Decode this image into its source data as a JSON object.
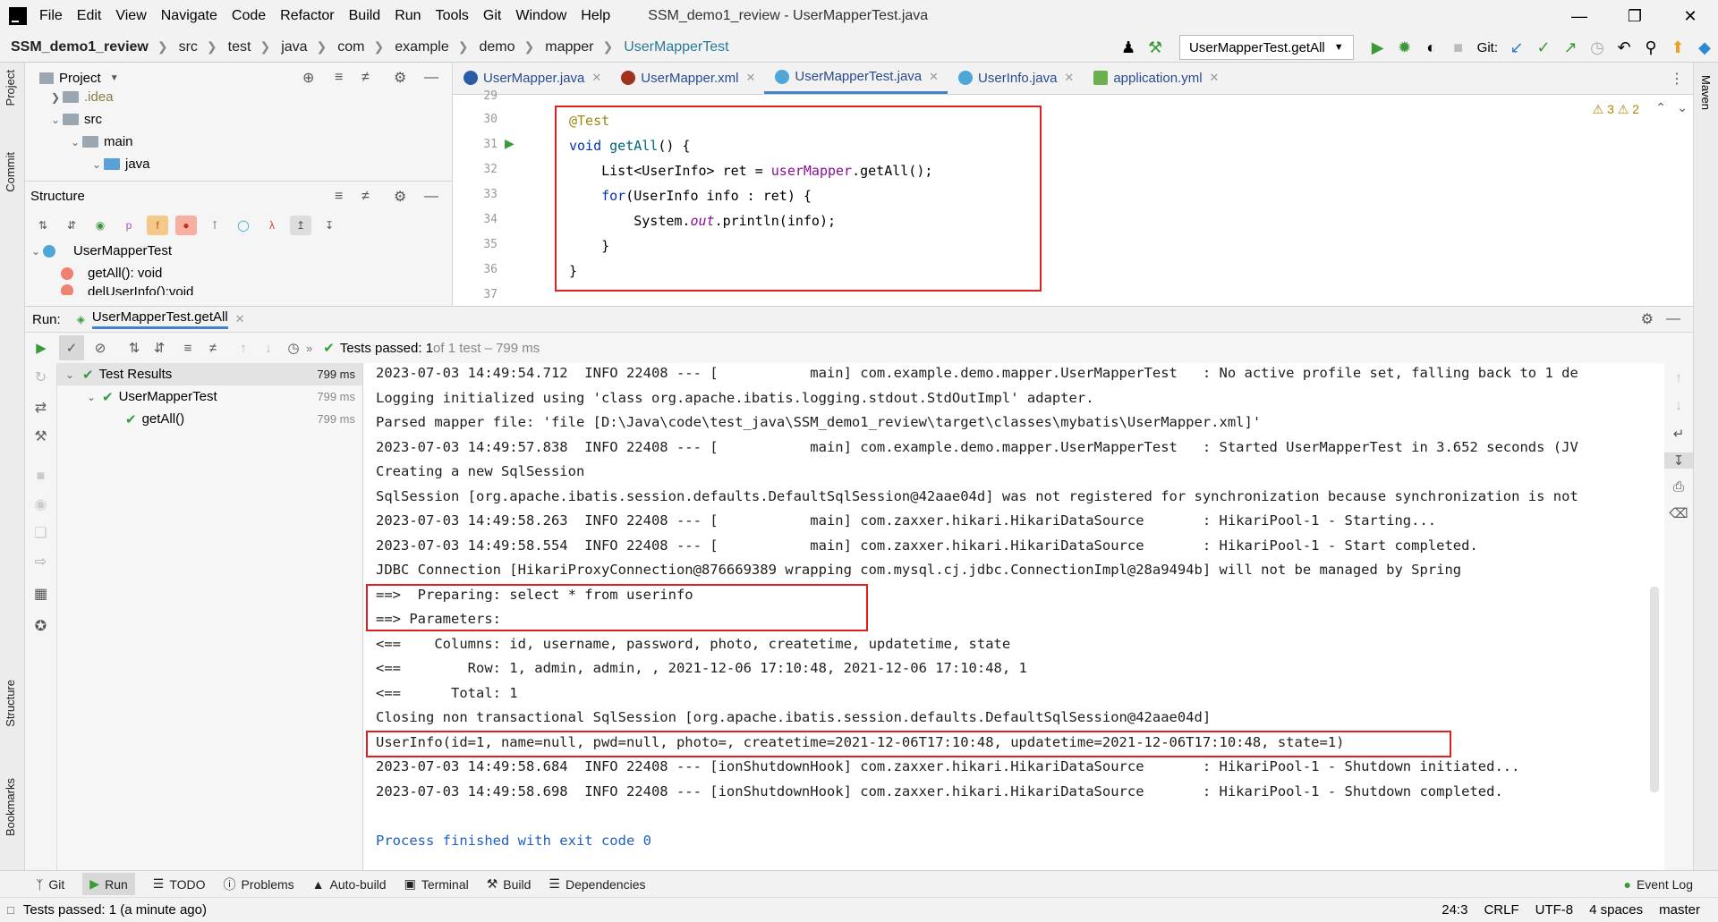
{
  "window": {
    "title": "SSM_demo1_review - UserMapperTest.java",
    "menu": [
      "File",
      "Edit",
      "View",
      "Navigate",
      "Code",
      "Refactor",
      "Build",
      "Run",
      "Tools",
      "Git",
      "Window",
      "Help"
    ]
  },
  "breadcrumb": [
    "SSM_demo1_review",
    "src",
    "test",
    "java",
    "com",
    "example",
    "demo",
    "mapper",
    "UserMapperTest"
  ],
  "run_config": "UserMapperTest.getAll",
  "git_label": "Git:",
  "project_panel": {
    "title": "Project",
    "tree": [
      {
        "label": ".idea",
        "indent": 1
      },
      {
        "label": "src",
        "indent": 1
      },
      {
        "label": "main",
        "indent": 2
      },
      {
        "label": "java",
        "indent": 3
      }
    ]
  },
  "structure_panel": {
    "title": "Structure",
    "items": [
      {
        "label": "UserMapperTest",
        "indent": 0
      },
      {
        "label": "getAll(): void",
        "indent": 1
      },
      {
        "label": "delUserInfo():void",
        "indent": 1
      }
    ]
  },
  "editor_tabs": [
    {
      "label": "UserMapper.java",
      "active": false
    },
    {
      "label": "UserMapper.xml",
      "active": false
    },
    {
      "label": "UserMapperTest.java",
      "active": true
    },
    {
      "label": "UserInfo.java",
      "active": false
    },
    {
      "label": "application.yml",
      "active": false
    }
  ],
  "editor": {
    "line_numbers": [
      "29",
      "30",
      "31",
      "32",
      "33",
      "34",
      "35",
      "36",
      "37"
    ],
    "code": {
      "l1": "@Test",
      "l2_kw": "void",
      "l2_fn": "getAll",
      "l2_rest": "() {",
      "l3_a": "    List<UserInfo> ret = ",
      "l3_fld": "userMapper",
      "l3_b": ".getAll();",
      "l4_kw": "    for",
      "l4_rest": "(UserInfo info : ret) {",
      "l5_a": "        System.",
      "l5_fld": "out",
      "l5_b": ".println(info);",
      "l6": "    }",
      "l7": "}"
    },
    "warnings": "⚠ 3  ⚠ 2"
  },
  "run_panel": {
    "label": "Run:",
    "tab": "UserMapperTest.getAll",
    "status_passed": "Tests passed: 1",
    "status_rest": " of 1 test – 799 ms"
  },
  "test_tree": [
    {
      "label": "Test Results",
      "time": "799 ms",
      "indent": 0
    },
    {
      "label": "UserMapperTest",
      "time": "799 ms",
      "indent": 1
    },
    {
      "label": "getAll()",
      "time": "799 ms",
      "indent": 2
    }
  ],
  "console_lines": [
    "2023-07-03 14:49:54.712  INFO 22408 --- [           main] com.example.demo.mapper.UserMapperTest   : No active profile set, falling back to 1 de",
    "Logging initialized using 'class org.apache.ibatis.logging.stdout.StdOutImpl' adapter.",
    "Parsed mapper file: 'file [D:\\Java\\code\\test_java\\SSM_demo1_review\\target\\classes\\mybatis\\UserMapper.xml]'",
    "2023-07-03 14:49:57.838  INFO 22408 --- [           main] com.example.demo.mapper.UserMapperTest   : Started UserMapperTest in 3.652 seconds (JV",
    "Creating a new SqlSession",
    "SqlSession [org.apache.ibatis.session.defaults.DefaultSqlSession@42aae04d] was not registered for synchronization because synchronization is not",
    "2023-07-03 14:49:58.263  INFO 22408 --- [           main] com.zaxxer.hikari.HikariDataSource       : HikariPool-1 - Starting...",
    "2023-07-03 14:49:58.554  INFO 22408 --- [           main] com.zaxxer.hikari.HikariDataSource       : HikariPool-1 - Start completed.",
    "JDBC Connection [HikariProxyConnection@876669389 wrapping com.mysql.cj.jdbc.ConnectionImpl@28a9494b] will not be managed by Spring",
    "==>  Preparing: select * from userinfo",
    "==> Parameters: ",
    "<==    Columns: id, username, password, photo, createtime, updatetime, state",
    "<==        Row: 1, admin, admin, , 2021-12-06 17:10:48, 2021-12-06 17:10:48, 1",
    "<==      Total: 1",
    "Closing non transactional SqlSession [org.apache.ibatis.session.defaults.DefaultSqlSession@42aae04d]",
    "UserInfo(id=1, name=null, pwd=null, photo=, createtime=2021-12-06T17:10:48, updatetime=2021-12-06T17:10:48, state=1)",
    "2023-07-03 14:49:58.684  INFO 22408 --- [ionShutdownHook] com.zaxxer.hikari.HikariDataSource       : HikariPool-1 - Shutdown initiated...",
    "2023-07-03 14:49:58.698  INFO 22408 --- [ionShutdownHook] com.zaxxer.hikari.HikariDataSource       : HikariPool-1 - Shutdown completed.",
    "",
    "Process finished with exit code 0"
  ],
  "bottom_tabs": [
    "Git",
    "Run",
    "TODO",
    "Problems",
    "Auto-build",
    "Terminal",
    "Build",
    "Dependencies"
  ],
  "event_log": "Event Log",
  "status_bar": {
    "message": "Tests passed: 1 (a minute ago)",
    "position": "24:3",
    "line_sep": "CRLF",
    "encoding": "UTF-8",
    "indent": "4 spaces",
    "branch": "master"
  },
  "side_tabs": {
    "project": "Project",
    "commit": "Commit",
    "structure": "Structure",
    "bookmarks": "Bookmarks",
    "maven": "Maven"
  },
  "colors": {
    "accent": "#4083c9",
    "highlight_box": "#e02020",
    "pass_green": "#2e9e3e"
  }
}
